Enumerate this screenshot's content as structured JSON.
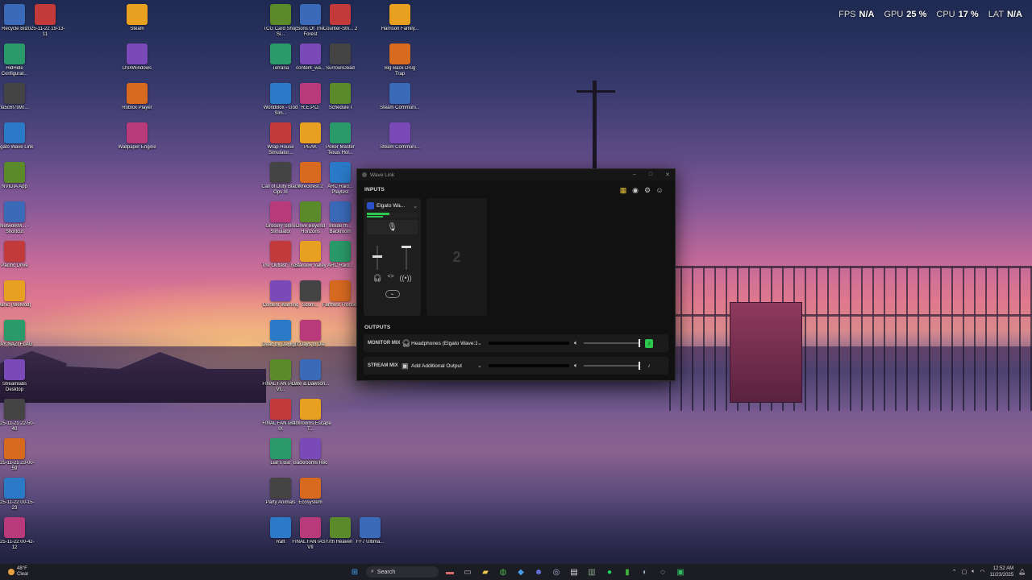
{
  "perf": {
    "fps_label": "FPS",
    "fps_value": "N/A",
    "gpu_label": "GPU",
    "gpu_value": "25 %",
    "cpu_label": "CPU",
    "cpu_value": "17 %",
    "lat_label": "LAT",
    "lat_value": "N/A"
  },
  "desktop_icons": [
    {
      "label": "Recycle Bin"
    },
    {
      "label": "2025-11-22 19-13-11"
    },
    {
      "label": "Steam"
    },
    {
      "label": "HidHide Configurat..."
    },
    {
      "label": "DS4Windows"
    },
    {
      "label": "fa5c6f7990..."
    },
    {
      "label": "Roblox Player"
    },
    {
      "label": "Elgato Wave Link"
    },
    {
      "label": "Wallpaper Engine"
    },
    {
      "label": "NVIDIA App"
    },
    {
      "label": "NetworkM... - Shortcut"
    },
    {
      "label": "Pacific Drive"
    },
    {
      "label": "Vanic (WeMod)"
    },
    {
      "label": "GAY NAZI FLAG"
    },
    {
      "label": "Streamlabs Desktop"
    },
    {
      "label": "2025-11-21 22-50-40"
    },
    {
      "label": "2025-11-21 23-00-59"
    },
    {
      "label": "2025-11-22 00-15-23"
    },
    {
      "label": "2025-11-22 00-42-12"
    },
    {
      "label": "TCG Card Shop Si..."
    },
    {
      "label": "Sons Of The Forest"
    },
    {
      "label": "Counter-Stri... 2"
    },
    {
      "label": "Harrison Family..."
    },
    {
      "label": "Terraria"
    },
    {
      "label": "content_wa..."
    },
    {
      "label": "SurrounDead"
    },
    {
      "label": "Big Back Drug Trap"
    },
    {
      "label": "WorldBox - God Sim..."
    },
    {
      "label": "R.E.P.O."
    },
    {
      "label": "Schedule I"
    },
    {
      "label": "Steam Communi..."
    },
    {
      "label": "Wrap House Simulator..."
    },
    {
      "label": "PEAK"
    },
    {
      "label": "Poker Master Texas Hol..."
    },
    {
      "label": "Steam Communi..."
    },
    {
      "label": "Call of Duty Black Ops III"
    },
    {
      "label": "Wreckfest 2"
    },
    {
      "label": "ARC Raid... Playtest"
    },
    {
      "label": "Grocery Store Simulator"
    },
    {
      "label": "Drive Beyond Horizons"
    },
    {
      "label": "Inside th... Backroom"
    },
    {
      "label": "The Outlast Trials"
    },
    {
      "label": "Stardew Valley"
    },
    {
      "label": "ARC Raid..."
    },
    {
      "label": "Content Warning"
    },
    {
      "label": "Scorn..."
    },
    {
      "label": "Farthest Frontier"
    },
    {
      "label": "Dead by Daylight"
    },
    {
      "label": "7 Days to Die"
    },
    {
      "label": "FINAL FANTASY VI..."
    },
    {
      "label": "Dale & Dawson..."
    },
    {
      "label": "FINAL FANTASY IX"
    },
    {
      "label": "Backrooms Escape T..."
    },
    {
      "label": "Liar's Bar"
    },
    {
      "label": "Backrooms Rec"
    },
    {
      "label": "Party Animals"
    },
    {
      "label": "Ecosystem"
    },
    {
      "label": "Raft"
    },
    {
      "label": "FINAL FANTASY VII"
    },
    {
      "label": "7th Heaven"
    },
    {
      "label": "FF7 Ultima..."
    }
  ],
  "wave_link": {
    "title": "Wave Link",
    "inputs_label": "INPUTS",
    "outputs_label": "OUTPUTS",
    "channel_name": "Elgato Wa...",
    "add_input_placeholder": "2",
    "meter_level": 0.45,
    "outputs": [
      {
        "mix": "MONITOR MIX",
        "device": "Headphones (Elgato Wave:1)",
        "volume": 1.0,
        "monitoring": true
      },
      {
        "mix": "STREAM MIX",
        "device": "Add Additional Output",
        "volume": 1.0,
        "monitoring": false
      }
    ]
  },
  "taskbar": {
    "weather_temp": "48°F",
    "weather_desc": "Clear",
    "search_placeholder": "Search",
    "time": "12:52 AM",
    "date": "11/23/2025"
  },
  "colors": {
    "accent_green": "#2cc64e",
    "window_bg": "#111111"
  }
}
